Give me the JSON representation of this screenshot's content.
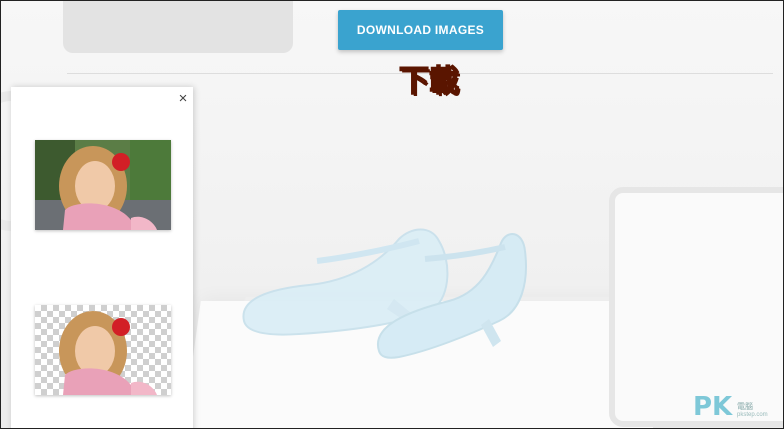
{
  "toolbar": {
    "download_label": "DOWNLOAD IMAGES"
  },
  "annotation": {
    "caption": "下載",
    "color": "#ff4a12"
  },
  "panel": {
    "close_glyph": "×",
    "thumbnails": [
      {
        "kind": "original photo",
        "icon": "girl-photo"
      },
      {
        "kind": "background removed",
        "icon": "girl-cutout"
      }
    ]
  },
  "watermark": {
    "brand": "PK",
    "sub": "電腦",
    "sub2": "pkstep.com"
  },
  "colors": {
    "accent": "#3aa3cf"
  }
}
